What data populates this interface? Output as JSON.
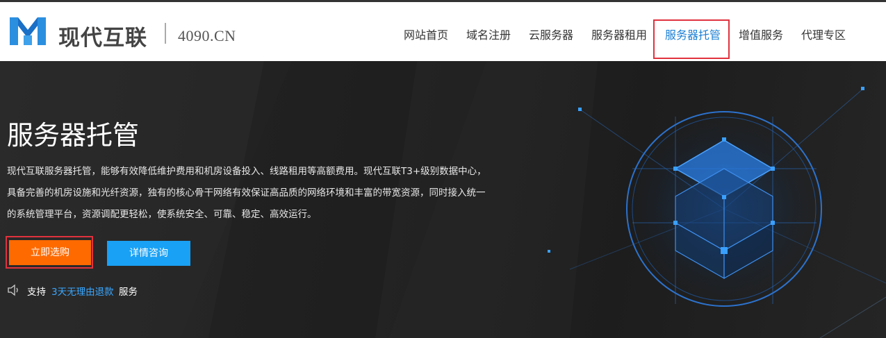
{
  "header": {
    "brand": "现代互联",
    "domain": "4090.CN",
    "nav": [
      {
        "label": "网站首页"
      },
      {
        "label": "域名注册"
      },
      {
        "label": "云服务器"
      },
      {
        "label": "服务器租用"
      },
      {
        "label": "服务器托管",
        "active": true
      },
      {
        "label": "增值服务"
      },
      {
        "label": "代理专区"
      }
    ]
  },
  "hero": {
    "title": "服务器托管",
    "description_lines": [
      "现代互联服务器托管，能够有效降低维护费用和机房设备投入、线路租用等高额费用。现代互联T3+级别数据中心，",
      "具备完善的机房设施和光纤资源，独有的核心骨干网络有效保证高品质的网络环境和丰富的带宽资源，同时接入统一",
      "的系统管理平台，资源调配更轻松，使系统安全、可靠、稳定、高效运行。"
    ],
    "buy_button": "立即选购",
    "consult_button": "详情咨询",
    "support_prefix": "支持",
    "support_link": "3天无理由退款",
    "support_suffix": "服务"
  },
  "colors": {
    "accent": "#1a7fd4",
    "buy": "#ff6a00",
    "consult": "#19a1f5",
    "highlight_box": "#e0323e"
  },
  "icons": {
    "logo": "logo-m-icon",
    "speaker": "speaker-icon"
  }
}
